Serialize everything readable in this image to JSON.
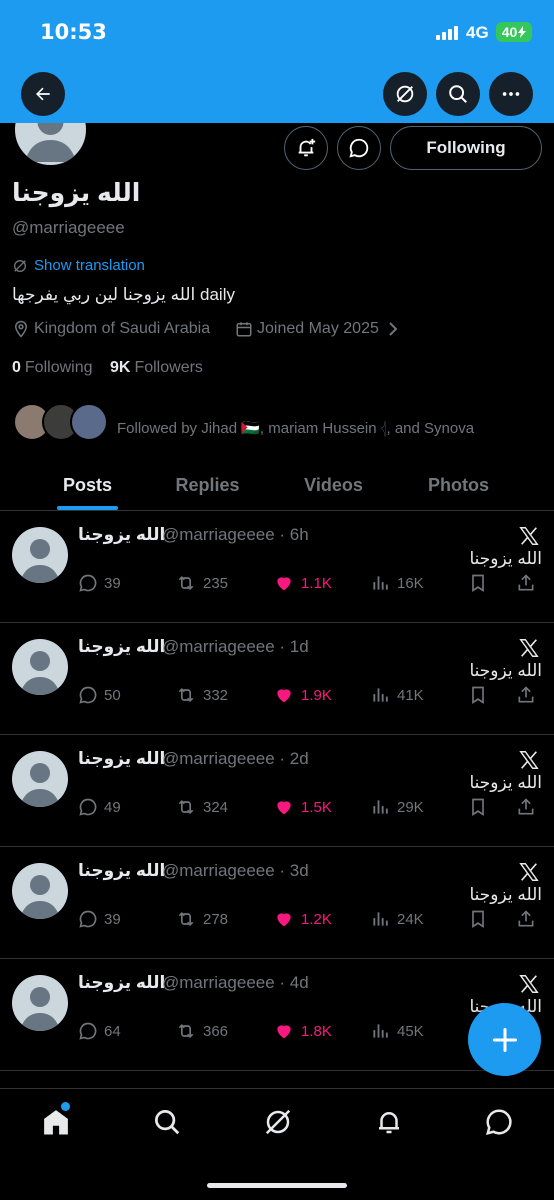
{
  "status": {
    "time": "10:53",
    "network": "4G",
    "battery": "40"
  },
  "profile": {
    "name": "الله يزوجنا",
    "handle": "@marriageeee",
    "show_translation": "Show translation",
    "bio": "الله يزوجنا لين ربي يفرجها daily",
    "location": "Kingdom of Saudi Arabia",
    "joined": "Joined May 2025",
    "following_count": "0",
    "following_label": "Following",
    "followers_count": "9K",
    "followers_label": "Followers",
    "followed_by": "Followed by Jihad 🇵🇸, mariam Hussein 𓂆, and Synova",
    "follow_button": "Following"
  },
  "tabs": [
    "Posts",
    "Replies",
    "Videos",
    "Photos"
  ],
  "posts": [
    {
      "name": "الله يزوجنا",
      "handle": "@marriageeee · 6h",
      "text": "الله يزوجنا",
      "replies": "39",
      "reposts": "235",
      "likes": "1.1K",
      "views": "16K"
    },
    {
      "name": "الله يزوجنا",
      "handle": "@marriageeee · 1d",
      "text": "الله يزوجنا",
      "replies": "50",
      "reposts": "332",
      "likes": "1.9K",
      "views": "41K"
    },
    {
      "name": "الله يزوجنا",
      "handle": "@marriageeee · 2d",
      "text": "الله يزوجنا",
      "replies": "49",
      "reposts": "324",
      "likes": "1.5K",
      "views": "29K"
    },
    {
      "name": "الله يزوجنا",
      "handle": "@marriageeee · 3d",
      "text": "الله يزوجنا",
      "replies": "39",
      "reposts": "278",
      "likes": "1.2K",
      "views": "24K"
    },
    {
      "name": "الله يزوجنا",
      "handle": "@marriageeee · 4d",
      "text": "الله يزوجنا",
      "replies": "64",
      "reposts": "366",
      "likes": "1.8K",
      "views": "45K"
    }
  ],
  "colors": {
    "accent": "#1d9bf0",
    "like": "#f91880",
    "background": "#000000",
    "muted": "#71767b"
  }
}
